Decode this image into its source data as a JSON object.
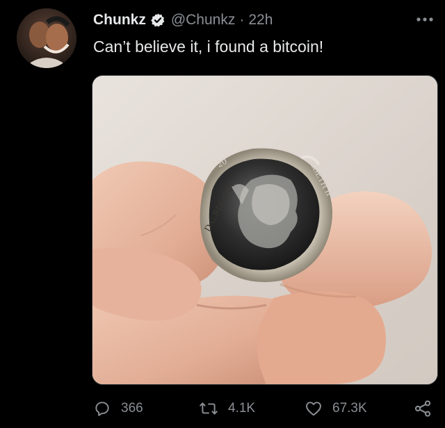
{
  "author": {
    "display_name": "Chunkz",
    "handle": "@Chunkz",
    "separator": "·",
    "time": "22h",
    "avatar_icon": "profile-photo-avatar",
    "verified_icon": "verified-badge-icon"
  },
  "tweet": {
    "text": "Can’t believe it, i found a bitcoin!",
    "media_icon": "photo-hand-holding-coin"
  },
  "coin": {
    "inscription_top_left": "20",
    "inscription_right": "ABETH II",
    "inscription_bottom": "D.G.REG.F.D."
  },
  "actions": {
    "reply_count": "366",
    "retweet_count": "4.1K",
    "like_count": "67.3K"
  },
  "colors": {
    "background": "#000000",
    "text_primary": "#e7e9ea",
    "text_secondary": "#8b8f94",
    "verified_badge": "#e7e9ea"
  }
}
